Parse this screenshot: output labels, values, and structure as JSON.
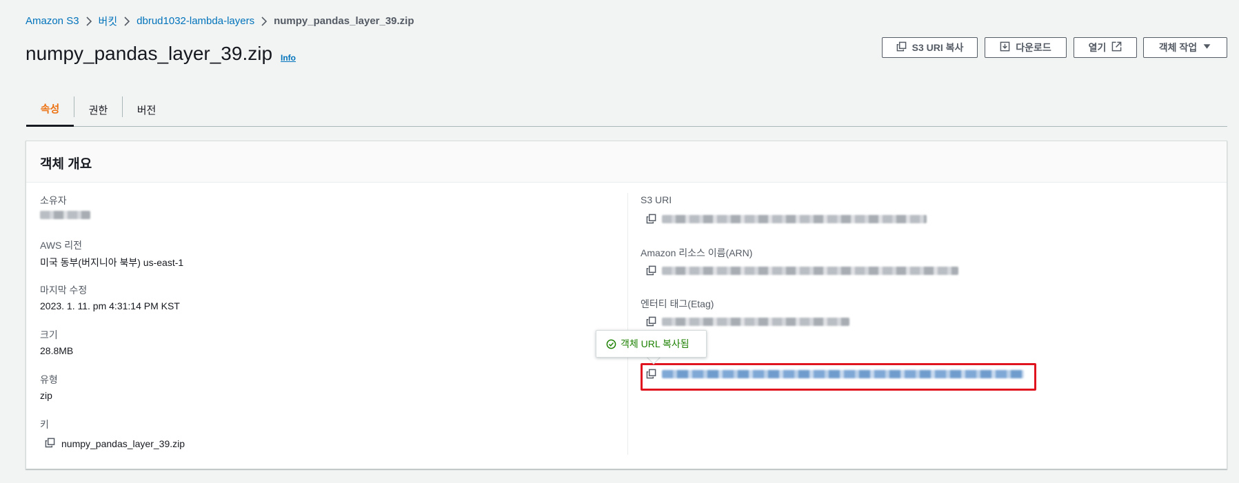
{
  "breadcrumb": {
    "items": [
      "Amazon S3",
      "버킷",
      "dbrud1032-lambda-layers"
    ],
    "current": "numpy_pandas_layer_39.zip"
  },
  "header": {
    "title": "numpy_pandas_layer_39.zip",
    "info_label": "Info"
  },
  "actions": {
    "copy_s3_uri": "S3 URI 복사",
    "download": "다운로드",
    "open": "열기",
    "object_actions": "객체 작업"
  },
  "tabs": [
    {
      "label": "속성",
      "active": true
    },
    {
      "label": "권한",
      "active": false
    },
    {
      "label": "버전",
      "active": false
    }
  ],
  "overview": {
    "title": "객체 개요",
    "left": {
      "owner_label": "소유자",
      "region_label": "AWS 리전",
      "region_value": "미국 동부(버지니아 북부) us-east-1",
      "modified_label": "마지막 수정",
      "modified_value": "2023. 1. 11. pm 4:31:14 PM KST",
      "size_label": "크기",
      "size_value": "28.8MB",
      "type_label": "유형",
      "type_value": "zip",
      "key_label": "키",
      "key_value": "numpy_pandas_layer_39.zip"
    },
    "right": {
      "s3_uri_label": "S3 URI",
      "arn_label": "Amazon 리소스 이름(ARN)",
      "etag_label": "엔터티 태그(Etag)"
    }
  },
  "tooltip": {
    "text": "객체 URL 복사됨"
  },
  "colors": {
    "link": "#0073bb",
    "active_tab": "#ec7211",
    "success": "#1d8102",
    "highlight": "#e0141e"
  }
}
